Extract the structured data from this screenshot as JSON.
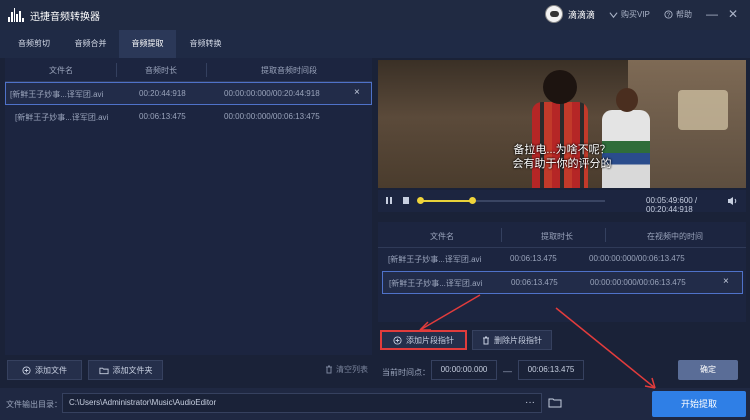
{
  "app": {
    "title": "迅捷音频转换器"
  },
  "user": {
    "name": "滴滴滴"
  },
  "titlebar": {
    "buy_vip": "购买VIP",
    "help": "帮助"
  },
  "tabs": [
    {
      "label": "音频剪切"
    },
    {
      "label": "音频合并"
    },
    {
      "label": "音频提取"
    },
    {
      "label": "音频转换"
    }
  ],
  "active_tab": "音频提取",
  "file_table": {
    "headers": {
      "name": "文件名",
      "duration": "音频时长",
      "range": "提取音频时间段"
    },
    "rows": [
      {
        "name": "[新鲜王子妙事...译军团.avi",
        "duration": "00:20:44:918",
        "range": "00:00:00:000/00:20:44:918",
        "close": "×"
      },
      {
        "name": "[新鲜王子妙事...译军团.avi",
        "duration": "00:06:13:475",
        "range": "00:00:00:000/00:06:13:475"
      }
    ]
  },
  "left_buttons": {
    "add_file": "添加文件",
    "add_folder": "添加文件夹",
    "clear_list": "清空列表"
  },
  "video": {
    "subtitle_line1": "备拉电...为啥不呢？",
    "subtitle_line2": "会有助于你的评分的",
    "time": "00:05:49:600 / 00:20:44:918",
    "progress": 0.28,
    "range_start": 0.0,
    "range_end": 0.28
  },
  "segment_table": {
    "headers": {
      "name": "文件名",
      "duration": "提取时长",
      "position": "在视频中的时间"
    },
    "rows": [
      {
        "name": "[新鲜王子妙事...译军团.avi",
        "duration": "00:06:13.475",
        "position": "00:00:00:000/00:06:13.475"
      },
      {
        "name": "[新鲜王子妙事...译军团.avi",
        "duration": "00:06:13.475",
        "position": "00:00:00:000/00:06:13.475",
        "close": "×"
      }
    ]
  },
  "segment_buttons": {
    "add": "添加片段指针",
    "delete": "删除片段指针"
  },
  "current_time": {
    "label": "当前时间点：",
    "start": "00:00:00.000",
    "end": "00:06:13.475",
    "dash": "—",
    "confirm": "确定"
  },
  "output": {
    "label": "文件输出目录：",
    "path": "C:\\Users\\Administrator\\Music\\AudioEditor",
    "more": "···"
  },
  "start_button": "开始提取",
  "colors": {
    "accent": "#2f7fe6",
    "highlight": "#e23c3c",
    "progress": "#e9d23a"
  }
}
